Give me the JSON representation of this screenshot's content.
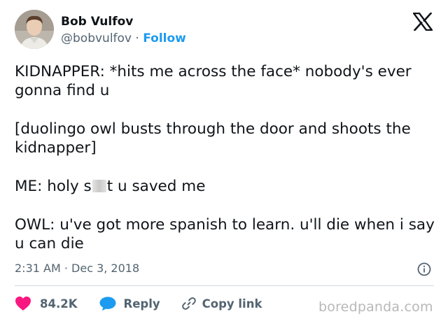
{
  "author": {
    "display_name": "Bob Vulfov",
    "handle": "@bobvulfov",
    "separator": "·",
    "follow_label": "Follow"
  },
  "brand": {
    "logo_icon": "x-logo-icon"
  },
  "tweet": {
    "paragraphs": {
      "p1": "KIDNAPPER: *hits me across the face* nobody's ever gonna find u",
      "p2": "[duolingo owl busts through the door and shoots the kidnapper]",
      "p3_before": "ME: holy s",
      "p3_after": "t u saved me",
      "p4": "OWL: u've got more spanish to learn. u'll die when i say u can die"
    },
    "timestamp": "2:31 AM · Dec 3, 2018"
  },
  "actions": {
    "likes_count": "84.2K",
    "reply_label": "Reply",
    "copy_link_label": "Copy link"
  },
  "watermark": "boredpanda.com",
  "colors": {
    "accent": "#1d9bf0",
    "like": "#f91880",
    "text": "#0f1419",
    "muted": "#536471"
  }
}
